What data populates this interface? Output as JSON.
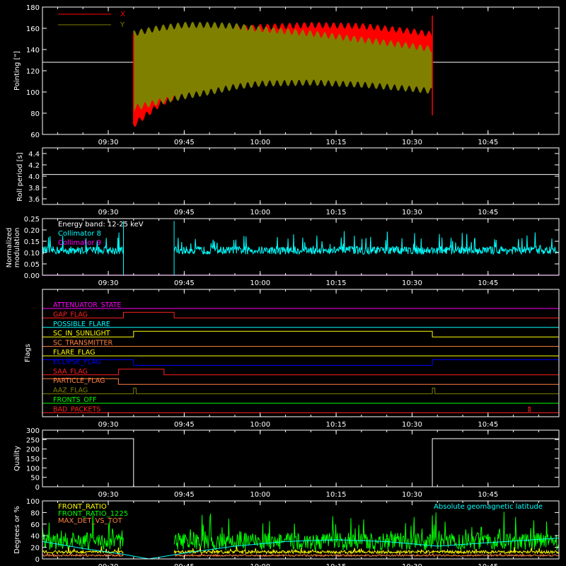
{
  "chart_data": [
    {
      "id": "pointing",
      "type": "line",
      "ylabel": "Pointing [\"]",
      "ylim": [
        60,
        180
      ],
      "yticks": [
        "60",
        "80",
        "100",
        "120",
        "140",
        "160",
        "180"
      ],
      "time_range": [
        "09:17",
        "10:59"
      ],
      "time_ticks": [
        "09:30",
        "09:45",
        "10:00",
        "10:15",
        "10:30",
        "10:45"
      ],
      "legend": [
        "X",
        "Y"
      ],
      "colors": {
        "X": "#ff0000",
        "Y": "#808000",
        "reference": "#ffffff"
      },
      "reference_line": 128,
      "data_start": "09:35",
      "data_end": "10:34",
      "x_envelope": {
        "time": [
          "09:35",
          "09:40",
          "09:45",
          "09:50",
          "09:55",
          "10:00",
          "10:10",
          "10:20",
          "10:30",
          "10:34"
        ],
        "upper": [
          150,
          153,
          156,
          159,
          162,
          164,
          166,
          165,
          160,
          157
        ],
        "lower": [
          66,
          85,
          98,
          110,
          117,
          120,
          122,
          123,
          121,
          120
        ]
      },
      "y_envelope": {
        "time": [
          "09:35",
          "09:40",
          "09:45",
          "09:50",
          "09:55",
          "10:00",
          "10:10",
          "10:20",
          "10:30",
          "10:34"
        ],
        "upper": [
          158,
          163,
          166,
          166,
          165,
          162,
          158,
          152,
          146,
          143
        ],
        "lower": [
          82,
          88,
          93,
          97,
          102,
          105,
          106,
          104,
          100,
          98
        ]
      }
    },
    {
      "id": "roll_period",
      "type": "line",
      "ylabel": "Roll period [s]",
      "ylim": [
        3.5,
        4.5
      ],
      "yticks": [
        "3.6",
        "3.8",
        "4.0",
        "4.2",
        "4.4"
      ],
      "time_ticks": [
        "09:30",
        "09:45",
        "10:00",
        "10:15",
        "10:30",
        "10:45"
      ],
      "series": [
        {
          "time": [
            "09:17",
            "10:59"
          ],
          "values": [
            4.03,
            4.03
          ]
        }
      ],
      "colors": {
        "line": "#ffffff"
      }
    },
    {
      "id": "modulation",
      "type": "line",
      "ylabel": [
        "Normalized",
        "modulation"
      ],
      "ylim": [
        0,
        0.25
      ],
      "yticks": [
        "0.00",
        "0.05",
        "0.10",
        "0.15",
        "0.20",
        "0.25"
      ],
      "time_ticks": [
        "09:30",
        "09:45",
        "10:00",
        "10:15",
        "10:30",
        "10:45"
      ],
      "legend_note": "Energy band: 12-25 keV",
      "legend": [
        "Collimator 8",
        "Collimator 9"
      ],
      "colors": {
        "Collimator 8": "#00ffff",
        "Collimator 9": "#ff00ff",
        "note": "#ffffff"
      },
      "collimator8_segments": [
        {
          "start": "09:17",
          "end": "09:33",
          "mean": 0.11
        },
        {
          "start": "09:43",
          "end": "10:59",
          "mean": 0.11
        }
      ],
      "collimator8_dropouts": [
        "09:33",
        "09:43"
      ],
      "collimator9_value": 0.0
    },
    {
      "id": "flags",
      "type": "line",
      "ylabel": "Flags",
      "time_ticks": [
        "09:30",
        "09:45",
        "10:00",
        "10:15",
        "10:30",
        "10:45"
      ],
      "flags": [
        {
          "label": "ATTENUATOR_STATE",
          "color": "#ff00ff",
          "steps": []
        },
        {
          "label": "GAP_FLAG",
          "color": "#ff2020",
          "steps": [
            {
              "start": "09:33",
              "end": "09:43"
            }
          ]
        },
        {
          "label": "POSSIBLE_FLARE",
          "color": "#00ffff",
          "steps": []
        },
        {
          "label": "SC_IN_SUNLIGHT",
          "color": "#ffff00",
          "steps": [
            {
              "start": "09:35",
              "end": "10:34"
            }
          ]
        },
        {
          "label": "SC_TRANSMITTER",
          "color": "#ff8040",
          "steps": []
        },
        {
          "label": "FLARE_FLAG",
          "color": "#ffff00",
          "steps": []
        },
        {
          "label": "ECLIPSE_FLAG",
          "color": "#0000ff",
          "steps": [
            {
              "start": "09:17",
              "end": "09:35"
            },
            {
              "start": "10:34",
              "end": "10:59"
            }
          ]
        },
        {
          "label": "SAA_FLAG",
          "color": "#ff2020",
          "steps": [
            {
              "start": "09:32",
              "end": "09:41"
            }
          ]
        },
        {
          "label": "PARTICLE_FLAG",
          "color": "#ff8040",
          "steps": [
            {
              "start": "09:17",
              "end": "09:32"
            }
          ]
        },
        {
          "label": "AAZ_FLAG",
          "color": "#808000",
          "steps": [
            {
              "start": "09:35",
              "end": "09:35.5"
            },
            {
              "start": "10:34",
              "end": "10:34.5"
            }
          ]
        },
        {
          "label": "FRONTS_OFF",
          "color": "#00ff00",
          "steps": []
        },
        {
          "label": "BAD_PACKETS",
          "color": "#ff2020",
          "steps": [
            {
              "start": "10:53",
              "end": "10:53.3"
            }
          ]
        }
      ]
    },
    {
      "id": "quality",
      "type": "line",
      "ylabel": "Quality",
      "ylim": [
        0,
        300
      ],
      "yticks": [
        "0",
        "50",
        "100",
        "150",
        "200",
        "250",
        "300"
      ],
      "time_ticks": [
        "09:30",
        "09:45",
        "10:00",
        "10:15",
        "10:30",
        "10:45"
      ],
      "series": [
        {
          "time": [
            "09:17",
            "09:35",
            "09:35",
            "10:34",
            "10:34",
            "10:59"
          ],
          "values": [
            255,
            255,
            0,
            0,
            255,
            255
          ]
        }
      ],
      "colors": {
        "line": "#ffffff"
      }
    },
    {
      "id": "ratios",
      "type": "line",
      "ylabel": "Degrees or %",
      "ylim": [
        0,
        100
      ],
      "yticks": [
        "0",
        "20",
        "40",
        "60",
        "80",
        "100"
      ],
      "time_ticks": [
        "09:30",
        "09:45",
        "10:00",
        "10:15",
        "10:30",
        "10:45"
      ],
      "legend": [
        "FRONT_RATIO",
        "FRONT_RATIO_1225",
        "MAX_DET_VS_TOT"
      ],
      "legend_right": "Absolute geomagnetic latitude",
      "colors": {
        "FRONT_RATIO": "#ffff00",
        "FRONT_RATIO_1225": "#00ff00",
        "MAX_DET_VS_TOT": "#ff8040",
        "latitude": "#00ffff"
      },
      "front_ratio_1225_mean": 30,
      "front_ratio_mean": 12,
      "max_det_vs_tot_mean": 6,
      "gap": [
        "09:33",
        "09:43"
      ],
      "latitude": {
        "time": [
          "09:17",
          "09:25",
          "09:33",
          "09:38",
          "09:45",
          "09:55",
          "10:05",
          "10:15",
          "10:25",
          "10:35",
          "10:45",
          "10:59"
        ],
        "values": [
          30,
          18,
          8,
          0,
          10,
          22,
          30,
          33,
          30,
          22,
          28,
          36
        ]
      }
    }
  ]
}
